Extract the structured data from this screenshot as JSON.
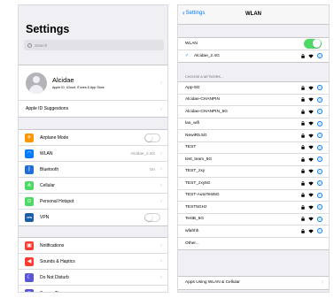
{
  "left": {
    "title": "Settings",
    "search_placeholder": "Search",
    "profile": {
      "name": "Alcidae",
      "subtitle": "Apple ID, iCloud, iTunes & App Store"
    },
    "suggestions": "Apple ID Suggestions",
    "network_items": [
      {
        "label": "Airplane Mode",
        "value": "",
        "icon": "airplane-icon",
        "toggle": false
      },
      {
        "label": "WLAN",
        "value": "Alcidae_2.4G",
        "icon": "wifi-icon"
      },
      {
        "label": "Bluetooth",
        "value": "On",
        "icon": "bluetooth-icon"
      },
      {
        "label": "Cellular",
        "value": "",
        "icon": "cellular-icon"
      },
      {
        "label": "Personal Hotspot",
        "value": "",
        "icon": "hotspot-icon"
      },
      {
        "label": "VPN",
        "value": "",
        "icon": "vpn-icon",
        "icon_text": "VPN",
        "toggle": false
      }
    ],
    "system_items": [
      {
        "label": "Notifications",
        "icon": "notifications-icon"
      },
      {
        "label": "Sounds & Haptics",
        "icon": "sounds-icon"
      },
      {
        "label": "Do Not Disturb",
        "icon": "moon-icon"
      },
      {
        "label": "Screen Time",
        "icon": "hourglass-icon"
      }
    ]
  },
  "right": {
    "back_label": "Settings",
    "title": "WLAN",
    "wlan_label": "WLAN",
    "wlan_enabled": true,
    "connected_network": "Alcidae_2.4G",
    "section_header": "CHOOSE A NETWORK...",
    "networks": [
      "App-5G",
      "Alcidae-CHANPIN",
      "Alcidae-CHANPIN_5G",
      "lao_wifi",
      "NewiR5.5G",
      "TEST",
      "test_team_5G",
      "TEST_zxy",
      "TEST_zxy5G",
      "TEST-AutoTest5G",
      "TEST5GHz",
      "TestB_5G",
      "wfahhh"
    ],
    "other_label": "Other...",
    "apps_row": "Apps Using WLAN & Cellular"
  },
  "colors": {
    "accent": "#007aff",
    "toggle_on": "#4cd964",
    "background": "#efeff4"
  }
}
